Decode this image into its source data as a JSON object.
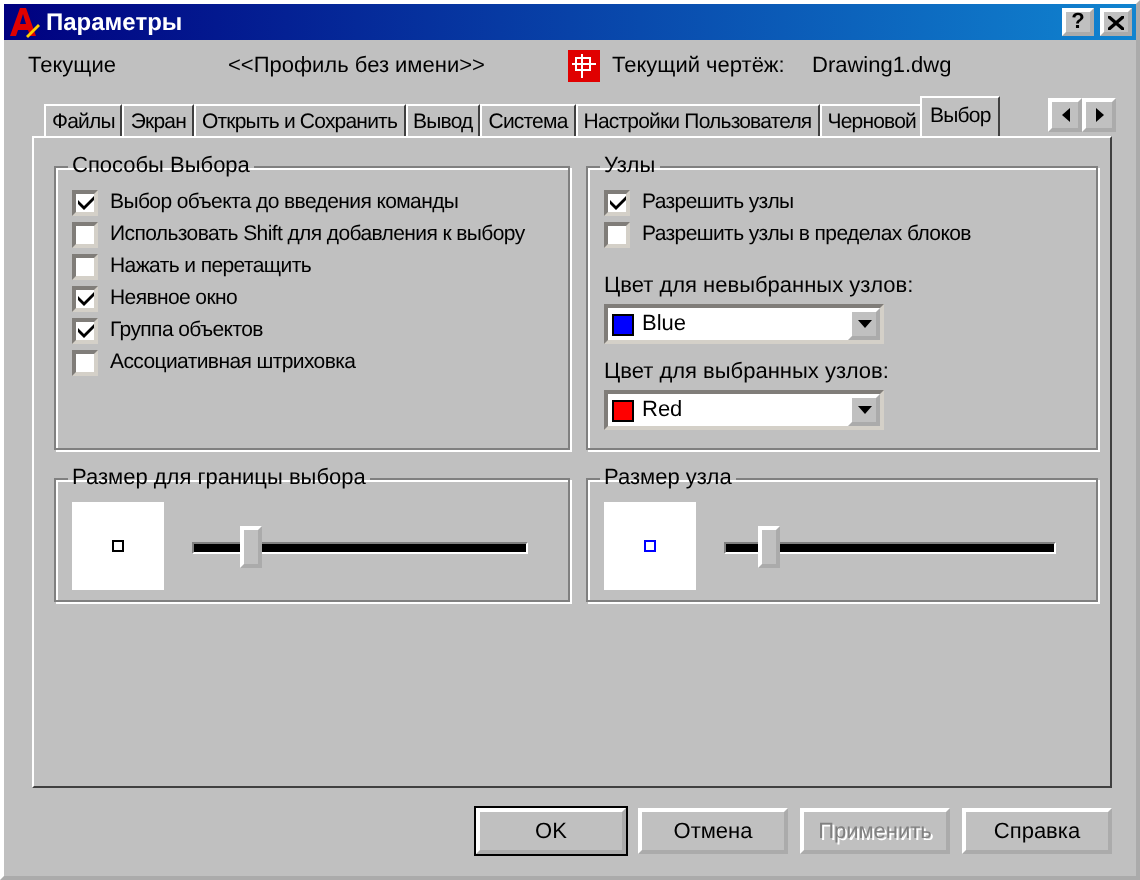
{
  "window": {
    "title": "Параметры",
    "help": "?"
  },
  "header": {
    "profile_label": "Текущие",
    "profile": "<<Профиль без имени>>",
    "drawing_label": "Текущий чертёж:",
    "drawing": "Drawing1.dwg"
  },
  "tabs": [
    {
      "label": "Файлы",
      "selected": false
    },
    {
      "label": "Экран",
      "selected": false
    },
    {
      "label": "Открыть и Сохранить",
      "selected": false
    },
    {
      "label": "Вывод",
      "selected": false
    },
    {
      "label": "Система",
      "selected": false
    },
    {
      "label": "Настройки Пользователя",
      "selected": false
    },
    {
      "label": "Черновой",
      "selected": false
    },
    {
      "label": "Выбор",
      "selected": true
    }
  ],
  "selection_modes": {
    "title": "Способы Выбора",
    "items": [
      {
        "label": "Выбор объекта до введения команды",
        "checked": true
      },
      {
        "label": "Использовать Shift для  добавления к выбору",
        "checked": false
      },
      {
        "label": "Нажать и перетащить",
        "checked": false
      },
      {
        "label": "Неявное окно",
        "checked": true
      },
      {
        "label": "Группа объектов",
        "checked": true
      },
      {
        "label": "Ассоциативная штриховка",
        "checked": false
      }
    ]
  },
  "grips": {
    "title": "Узлы",
    "items": [
      {
        "label": "Разрешить узлы",
        "checked": true
      },
      {
        "label": "Разрешить узлы в пределах блоков",
        "checked": false
      }
    ],
    "colors": [
      {
        "label": "Цвет для невыбранных узлов:",
        "value": "Blue",
        "color": "#0000ff"
      },
      {
        "label": "Цвет для выбранных узлов:",
        "value": "Red",
        "color": "#ff0000"
      }
    ]
  },
  "pickbox_size": {
    "title": "Размер для границы выбора",
    "level": 0.17
  },
  "grip_size": {
    "title": "Размер узла",
    "level": 0.13
  },
  "buttons": [
    {
      "label": "OK",
      "disabled": false,
      "default": true
    },
    {
      "label": "Отмена",
      "disabled": false,
      "default": false
    },
    {
      "label": "Применить",
      "disabled": true,
      "default": false
    },
    {
      "label": "Справка",
      "disabled": false,
      "default": false
    }
  ]
}
